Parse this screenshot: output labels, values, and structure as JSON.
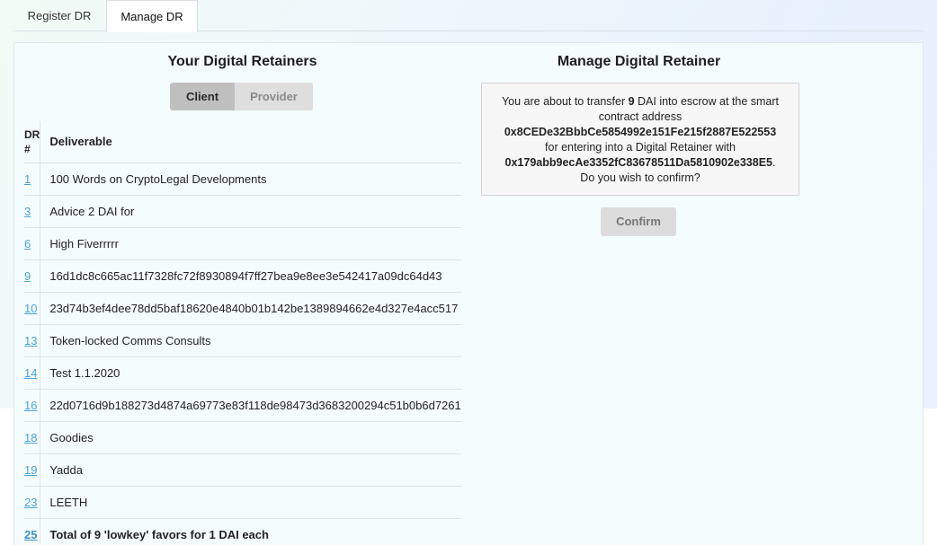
{
  "tabs": [
    {
      "label": "Register DR",
      "active": false
    },
    {
      "label": "Manage DR",
      "active": true
    }
  ],
  "left": {
    "title": "Your Digital Retainers",
    "toggle": {
      "client_label": "Client",
      "provider_label": "Provider",
      "selected": "Client"
    },
    "table": {
      "headers": {
        "dr": "DR #",
        "deliverable": "Deliverable"
      },
      "rows": [
        {
          "dr": "1",
          "deliverable": "100 Words on CryptoLegal Developments"
        },
        {
          "dr": "3",
          "deliverable": "Advice 2 DAI for"
        },
        {
          "dr": "6",
          "deliverable": "High Fiverrrrr"
        },
        {
          "dr": "9",
          "deliverable": "16d1dc8c665ac11f7328fc72f8930894f7ff27bea9e8ee3e542417a09dc64d43"
        },
        {
          "dr": "10",
          "deliverable": "23d74b3ef4dee78dd5baf18620e4840b01b142be1389894662e4d327e4acc517"
        },
        {
          "dr": "13",
          "deliverable": "Token-locked Comms Consults"
        },
        {
          "dr": "14",
          "deliverable": "Test 1.1.2020"
        },
        {
          "dr": "16",
          "deliverable": "22d0716d9b188273d4874a69773e83f118de98473d3683200294c51b0b6d7261"
        },
        {
          "dr": "18",
          "deliverable": "Goodies"
        },
        {
          "dr": "19",
          "deliverable": "Yadda"
        },
        {
          "dr": "23",
          "deliverable": "LEETH"
        },
        {
          "dr": "25",
          "deliverable": "Total of 9 'lowkey' favors for 1 DAI each"
        }
      ]
    }
  },
  "right": {
    "title": "Manage Digital Retainer",
    "notice": {
      "pre_amount": "You are about to transfer ",
      "amount": "9",
      "post_amount": " DAI into escrow at the smart contract address",
      "contract_address": "0x8CEDe32BbbCe5854992e151Fe215f2887E522553",
      "middle": "for entering into a Digital Retainer with",
      "counterparty_address": "0x179abb9ecAe3352fC83678511Da5810902e338E5",
      "period": ".",
      "question": "Do you wish to confirm?"
    },
    "confirm_label": "Confirm"
  }
}
